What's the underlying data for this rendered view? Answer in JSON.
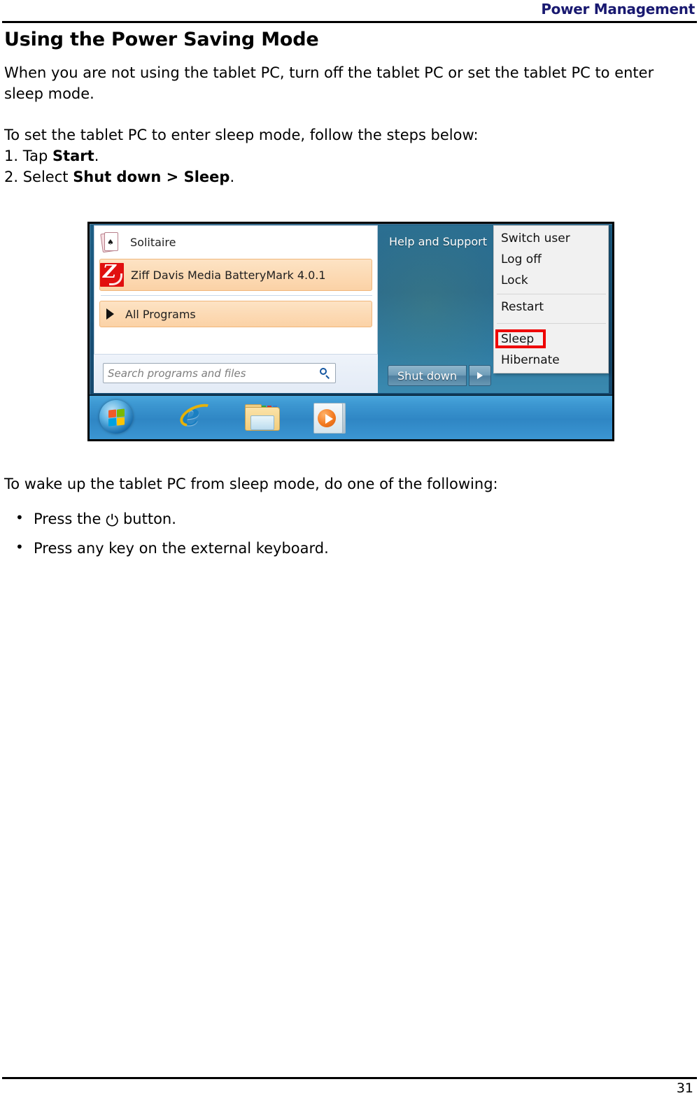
{
  "document": {
    "header_title": "Power Management",
    "page_number": "31",
    "heading": "Using the Power Saving Mode",
    "intro_paragraph": "When you are not using the tablet PC, turn off the tablet PC or set the tablet PC to enter sleep mode.",
    "instruction_lead": "To set the tablet PC to enter sleep mode, follow the steps below:",
    "steps": [
      {
        "number": "1. ",
        "prefix": "Tap ",
        "bold": "Start",
        "suffix": "."
      },
      {
        "number": "2. ",
        "prefix": "Select ",
        "bold": "Shut down > Sleep",
        "suffix": "."
      }
    ],
    "wake_lead": "To wake up the tablet PC from sleep mode, do one of the following:",
    "bullets": [
      {
        "prefix": "Press the ",
        "glyph": "⏻",
        "suffix": " button."
      },
      {
        "prefix": "Press any key on the external keyboard.",
        "glyph": "",
        "suffix": ""
      }
    ]
  },
  "figure": {
    "caption_alt": "Windows 7 Start menu with Shut down submenu, Sleep highlighted",
    "start_menu": {
      "left_pane": {
        "items": [
          {
            "label": "Solitaire",
            "icon": "solitaire-cards-icon",
            "highlighted": false
          },
          {
            "label": "Ziff Davis Media BatteryMark 4.0.1",
            "icon": "ziff-davis-z-icon",
            "highlighted": true
          },
          {
            "label": "All Programs",
            "icon": "triangle-right-icon",
            "highlighted": true
          }
        ],
        "search_placeholder": "Search programs and files",
        "search_icon": "magnifier-icon"
      },
      "right_pane": {
        "items": [
          "Help and Support"
        ],
        "shutdown_button": "Shut down",
        "shutdown_arrow_icon": "triangle-right-icon"
      },
      "context_menu": {
        "items": [
          {
            "label": "Switch user",
            "highlighted": false
          },
          {
            "label": "Log off",
            "highlighted": false
          },
          {
            "label": "Lock",
            "highlighted": false
          },
          {
            "label": "Restart",
            "highlighted": false
          },
          {
            "label": "Sleep",
            "highlighted": true
          },
          {
            "label": "Hibernate",
            "highlighted": false
          }
        ],
        "highlight_color": "#ee0000"
      }
    },
    "taskbar": {
      "items": [
        {
          "name": "start-orb-icon"
        },
        {
          "name": "internet-explorer-icon"
        },
        {
          "name": "windows-explorer-folder-icon"
        },
        {
          "name": "windows-media-player-icon"
        }
      ]
    }
  },
  "colors": {
    "header_text": "#191970",
    "highlight_red": "#ee0000",
    "menu_hover": "#fbd2a6",
    "taskbar_blue": "#2f86c4"
  }
}
